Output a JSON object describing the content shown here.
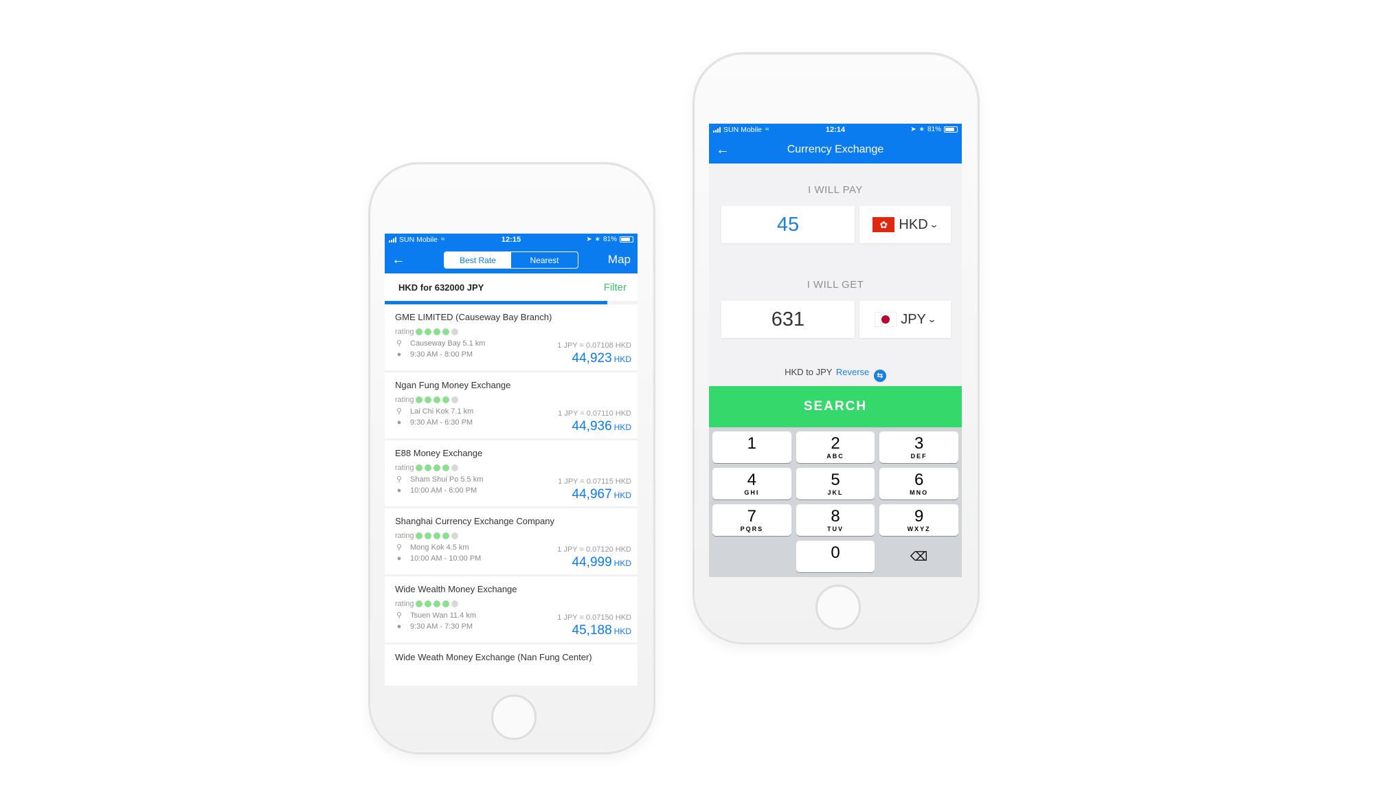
{
  "left_phone": {
    "status": {
      "carrier": "SUN Mobile",
      "time": "12:15",
      "battery": "81%"
    },
    "nav": {
      "tabs": [
        {
          "label": "Best Rate",
          "active": false
        },
        {
          "label": "Nearest",
          "active": true
        }
      ],
      "map_label": "Map"
    },
    "query_title": "HKD for 632000 JPY",
    "filter_label": "Filter",
    "results": [
      {
        "name": "GME LIMITED (Causeway Bay Branch)",
        "rating_label": "rating",
        "rating": 4,
        "location": "Causeway Bay 5.1 km",
        "hours": "9:30 AM - 8:00 PM",
        "rate": "1 JPY = 0.07108 HKD",
        "amount": "44,923",
        "currency": "HKD"
      },
      {
        "name": "Ngan Fung Money Exchange",
        "rating_label": "rating",
        "rating": 4,
        "location": "Lai Chi Kok 7.1 km",
        "hours": "9:30 AM - 6:30 PM",
        "rate": "1 JPY = 0.07110 HKD",
        "amount": "44,936",
        "currency": "HKD"
      },
      {
        "name": "E88 Money Exchange",
        "rating_label": "rating",
        "rating": 4,
        "location": "Sham Shui Po 5.5 km",
        "hours": "10:00 AM - 6:00 PM",
        "rate": "1 JPY = 0.07115 HKD",
        "amount": "44,967",
        "currency": "HKD"
      },
      {
        "name": "Shanghai Currency Exchange Company",
        "rating_label": "rating",
        "rating": 4,
        "location": "Mong Kok 4.5 km",
        "hours": "10:00 AM - 10:00 PM",
        "rate": "1 JPY = 0.07120 HKD",
        "amount": "44,999",
        "currency": "HKD"
      },
      {
        "name": "Wide Wealth Money Exchange",
        "rating_label": "rating",
        "rating": 4,
        "location": "Tsuen Wan 11.4 km",
        "hours": "9:30 AM - 7:30 PM",
        "rate": "1 JPY = 0.07150 HKD",
        "amount": "45,188",
        "currency": "HKD"
      }
    ],
    "partial_result": {
      "name": "Wide Weath Money Exchange (Nan Fung Center)"
    }
  },
  "right_phone": {
    "status": {
      "carrier": "SUN Mobile",
      "time": "12:14",
      "battery": "81%"
    },
    "title": "Currency Exchange",
    "pay_label": "I WILL PAY",
    "pay_amount": "45",
    "pay_currency": "HKD",
    "get_label": "I WILL GET",
    "get_amount": "631",
    "get_currency": "JPY",
    "direction_text": "HKD to JPY",
    "reverse_label": "Reverse",
    "search_label": "SEARCH",
    "keypad": [
      {
        "digit": "1",
        "letters": ""
      },
      {
        "digit": "2",
        "letters": "ABC"
      },
      {
        "digit": "3",
        "letters": "DEF"
      },
      {
        "digit": "4",
        "letters": "GHI"
      },
      {
        "digit": "5",
        "letters": "JKL"
      },
      {
        "digit": "6",
        "letters": "MNO"
      },
      {
        "digit": "7",
        "letters": "PQRS"
      },
      {
        "digit": "8",
        "letters": "TUV"
      },
      {
        "digit": "9",
        "letters": "WXYZ"
      },
      {
        "digit": "0",
        "letters": ""
      }
    ]
  },
  "colors": {
    "brand_blue": "#0a7cf0",
    "search_green": "#35d86a",
    "filter_green": "#35c76a",
    "rating_green": "#8be08f"
  },
  "icons": {
    "back": "arrow-left-icon",
    "location": "map-pin-icon",
    "hours": "clock-icon",
    "reverse": "swap-icon",
    "delete": "backspace-icon",
    "dropdown": "chevron-down-icon"
  }
}
